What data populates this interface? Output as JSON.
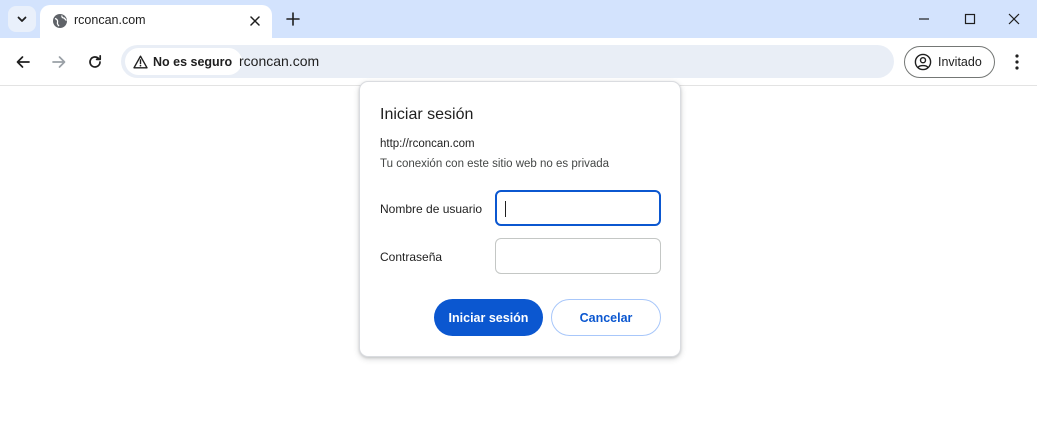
{
  "browser": {
    "tab": {
      "title": "rconcan.com",
      "favicon": "globe-icon"
    },
    "toolbar": {
      "security_label": "No es seguro",
      "url": "rconcan.com",
      "profile_label": "Invitado"
    }
  },
  "dialog": {
    "title": "Iniciar sesión",
    "origin": "http://rconcan.com",
    "warning": "Tu conexión con este sitio web no es privada",
    "username_label": "Nombre de usuario",
    "username_value": "",
    "password_label": "Contraseña",
    "password_value": "",
    "submit_label": "Iniciar sesión",
    "cancel_label": "Cancelar"
  },
  "colors": {
    "tabstrip_bg": "#d3e3fd",
    "accent": "#0b57d0",
    "omnibox_bg": "#e9eef6"
  }
}
